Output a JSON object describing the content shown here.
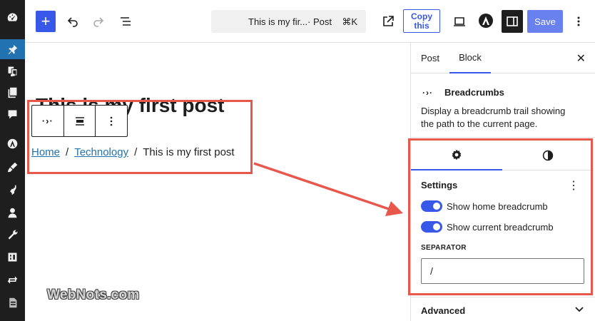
{
  "toolbar": {
    "add_label": "+",
    "doc_title": "This is my fir...",
    "doc_type": "· Post",
    "doc_shortcut": "⌘K",
    "copy_line1": "Copy",
    "copy_line2": "this",
    "save_label": "Save",
    "icons": [
      "undo-icon",
      "redo-icon",
      "list-view-icon",
      "external-view-icon",
      "desktop-preview-icon",
      "astra-icon",
      "sidebar-toggle-icon",
      "options-icon"
    ]
  },
  "editor": {
    "post_title": "This is my first post",
    "block_type_glyph": "·›·",
    "breadcrumb": {
      "home": "Home",
      "category": "Technology",
      "current": "This is my first post",
      "separator": "/"
    }
  },
  "sidebar": {
    "tab_post": "Post",
    "tab_block": "Block",
    "close_label": "✕",
    "block_icon_glyph": "·›·",
    "block_title": "Breadcrumbs",
    "block_description": "Display a breadcrumb trail showing the path to the current page.",
    "settings_heading": "Settings",
    "settings_menu": "⋮",
    "show_home_label": "Show home breadcrumb",
    "show_home_checked": true,
    "show_current_label": "Show current breadcrumb",
    "show_current_checked": true,
    "separator_label": "Separator",
    "separator_value": "/",
    "advanced_label": "Advanced"
  },
  "admin_menu_icons": [
    "dashboard-icon",
    "pin-icon",
    "media-icon",
    "pages-icon",
    "comments-icon",
    "astra-icon",
    "appearance-icon",
    "plugins-icon",
    "users-icon",
    "tools-icon",
    "settings-icon",
    "sync-icon",
    "doc-icon"
  ],
  "colors": {
    "accent": "#3858e9",
    "link": "#2271b1",
    "annotation": "#e8574b",
    "admin_bg": "#1e1e1e"
  },
  "watermark": "WebNots.com"
}
